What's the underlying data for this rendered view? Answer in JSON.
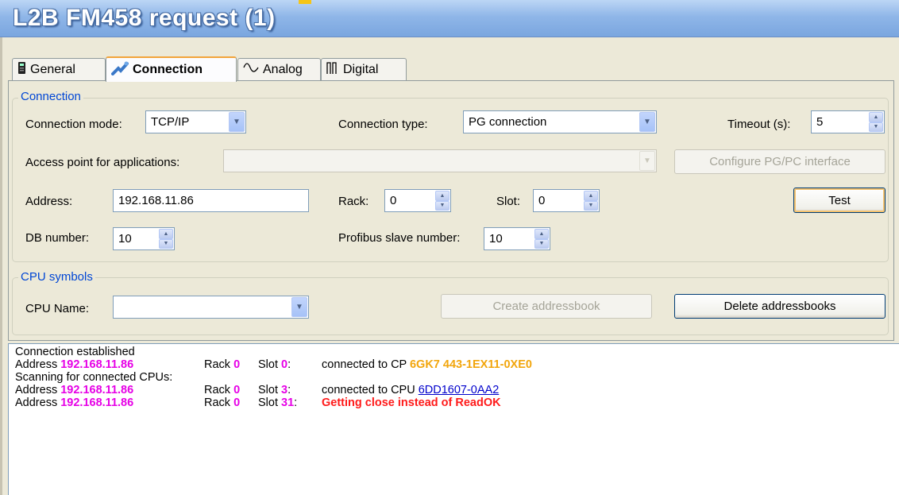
{
  "window": {
    "title": "L2B FM458 request (1)"
  },
  "tabs": [
    {
      "label": "General",
      "icon": "device-icon",
      "active": false
    },
    {
      "label": "Connection",
      "icon": "network-plug-icon",
      "active": true
    },
    {
      "label": "Analog",
      "icon": "sine-wave-icon",
      "active": false
    },
    {
      "label": "Digital",
      "icon": "pulse-wave-icon",
      "active": false
    }
  ],
  "connection": {
    "legend": "Connection",
    "mode_label": "Connection mode:",
    "mode_value": "TCP/IP",
    "type_label": "Connection type:",
    "type_value": "PG connection",
    "timeout_label": "Timeout (s):",
    "timeout_value": "5",
    "access_label": "Access point for applications:",
    "access_value": "",
    "configure_label": "Configure PG/PC interface",
    "address_label": "Address:",
    "address_value": "192.168.11.86",
    "rack_label": "Rack:",
    "rack_value": "0",
    "slot_label": "Slot:",
    "slot_value": "0",
    "test_label": "Test",
    "db_label": "DB number:",
    "db_value": "10",
    "profibus_label": "Profibus slave number:",
    "profibus_value": "10"
  },
  "cpu_symbols": {
    "legend": "CPU symbols",
    "name_label": "CPU Name:",
    "name_value": "",
    "create_label": "Create addressbook",
    "delete_label": "Delete addressbooks"
  },
  "log": {
    "line1": "Connection established",
    "line3": "Scanning for connected CPUs:",
    "address_word": "Address",
    "rack_word": "Rack",
    "slot_word": "Slot",
    "ip": "192.168.11.86",
    "rack": "0",
    "slot_a": "0",
    "slot_b": "3",
    "slot_c": "31",
    "colon": ":",
    "cp_text": "connected to CP",
    "cp_id": "6GK7 443-1EX11-0XE0",
    "cpu_text": "connected to CPU",
    "cpu_id": "6DD1607-0AA2",
    "error": "Getting close instead of ReadOK"
  },
  "colors": {
    "accent_orange": "#f2a60d",
    "highlight_magenta": "#e600e6",
    "error_red": "#ff1a1a",
    "link_blue": "#0000cc",
    "legend_blue": "#0046d5"
  }
}
